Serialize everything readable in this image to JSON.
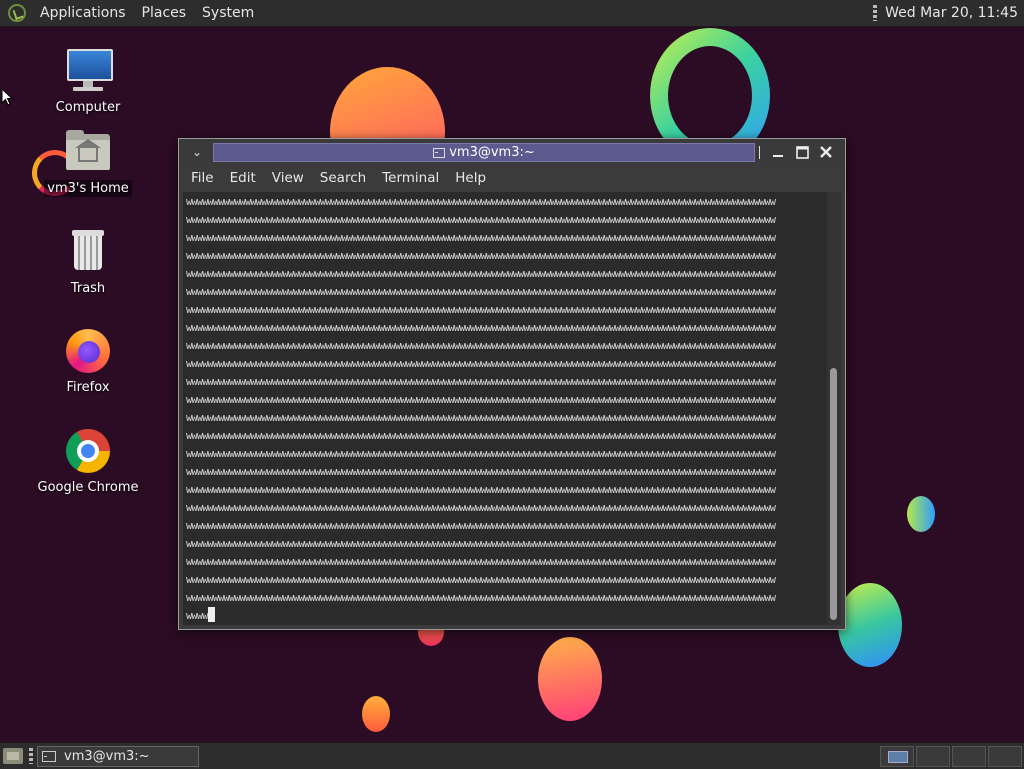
{
  "top_panel": {
    "menus": [
      "Applications",
      "Places",
      "System"
    ],
    "clock": "Wed Mar 20, 11:45"
  },
  "desktop": {
    "icons": [
      {
        "label": "Computer",
        "icon": "computer-icon"
      },
      {
        "label": "vm3's Home",
        "icon": "home-folder-icon"
      },
      {
        "label": "Trash",
        "icon": "trash-icon"
      },
      {
        "label": "Firefox",
        "icon": "firefox-icon"
      },
      {
        "label": "Google Chrome",
        "icon": "chrome-icon"
      }
    ]
  },
  "terminal": {
    "title": "vm3@vm3:~",
    "menu": [
      "File",
      "Edit",
      "View",
      "Search",
      "Terminal",
      "Help"
    ],
    "line_text": "wwwwwwwwwwwwwwwwwwwwwwwwwwwwwwwwwwwwwwwwwwwwwwwwwwwwwwwwwwwwwwwwwwwwwwwwwwwwwwwwwwwwwwwwwwwwwwwwwwwwwwwwwwwwww",
    "line_count": 23,
    "prompt_line": "wwww"
  },
  "taskbar": {
    "task_label": "vm3@vm3:~"
  },
  "colors": {
    "panel": "#2d2d2d",
    "title_active": "#5d5a8f",
    "desktop_bg": "#2b0c24"
  }
}
